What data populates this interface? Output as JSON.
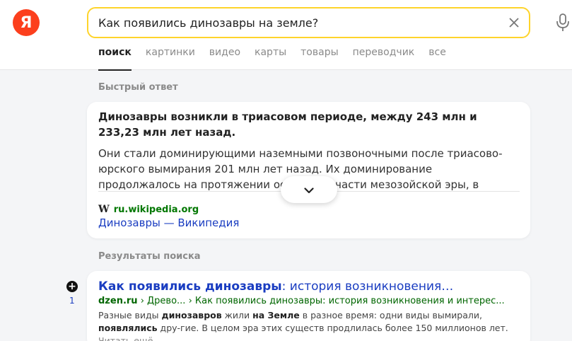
{
  "logo": {
    "text": "Я"
  },
  "search": {
    "query": "Как появились динозавры на земле?"
  },
  "icons": {
    "clear": "close-icon",
    "mic": "microphone-icon",
    "expand": "chevron-down-icon",
    "wiki": "wikipedia-icon"
  },
  "tabs": [
    "поиск",
    "картинки",
    "видео",
    "карты",
    "товары",
    "переводчик",
    "все"
  ],
  "quick_answer": {
    "section_label": "Быстрый ответ",
    "title": "Динозавры возникли в триасовом периоде, между 243 млн и 233,23 млн лет назад.",
    "text": "Они стали доминирующими наземными позвоночными после триасово-юрского вымирания 201 млн лет назад. Их доминирование продолжалось на протяжении остальной части мезозойской эры, в течение юрского и мелового",
    "source_icon": "W",
    "source_domain": "ru.wikipedia.org",
    "source_title": "Динозавры — Википедия"
  },
  "results": {
    "section_label": "Результаты поиска",
    "items": [
      {
        "title_bold": "Как появились динозавры",
        "title_rest": ": история возникновения…",
        "domain": "dzen.ru",
        "path": " › Древо... › Как появились динозавры: история возникновения и интерес...",
        "snippet_1": "Разные виды ",
        "snippet_b1": "динозавров",
        "snippet_2": " жили ",
        "snippet_b2": "на Земле",
        "snippet_3": " в разное время: одни виды вымирали, ",
        "snippet_b3": "появлялись",
        "snippet_4": " дру-гие. В целом эра этих существ продлилась более 150 миллионов лет. ",
        "read_more": "Читать ещё",
        "plus_symbol": "+",
        "plus_count": "1"
      }
    ]
  },
  "colors": {
    "accent": "#fc3f1d",
    "search_border": "#fed42b",
    "link": "#1a3dc1",
    "url": "#007700"
  }
}
